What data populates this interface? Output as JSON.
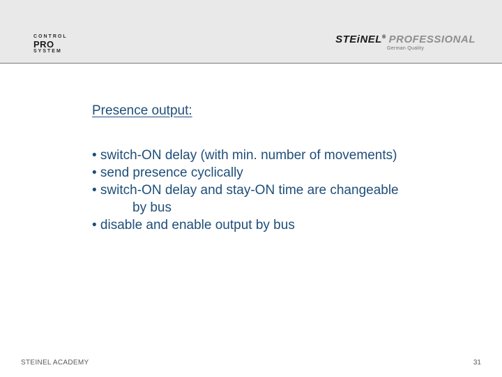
{
  "header": {
    "logo_left": {
      "line1": "CONTROL",
      "line2": "PRO",
      "line3": "SYSTEM"
    },
    "logo_right": {
      "brand_main": "STEiNEL",
      "brand_sub": "PROFESSIONAL",
      "reg": "®",
      "tagline": "German Quality"
    }
  },
  "content": {
    "section_title": "Presence output:",
    "bullets": {
      "b1": "• switch-ON delay (with min. number of movements)",
      "b2": "• send presence cyclically",
      "b3": "• switch-ON delay and stay-ON time are changeable",
      "b3_cont": "by bus",
      "b4": "• disable and enable output by bus"
    }
  },
  "footer": {
    "left": "STEINEL ACADEMY",
    "page": "31"
  }
}
